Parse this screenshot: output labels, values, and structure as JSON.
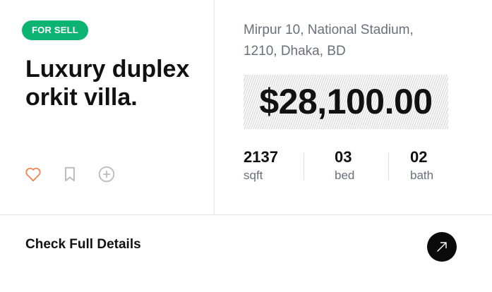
{
  "listing": {
    "badge": "FOR SELL",
    "title": "Luxury duplex orkit villa.",
    "address_line1": "Mirpur 10, National Stadium,",
    "address_line2": "1210, Dhaka, BD",
    "price": "$28,100.00",
    "stats": [
      {
        "value": "2137",
        "unit": "sqft"
      },
      {
        "value": "03",
        "unit": "bed"
      },
      {
        "value": "02",
        "unit": "bath"
      }
    ]
  },
  "actions": {
    "icons": [
      "heart-icon",
      "bookmark-icon",
      "plus-circle-icon"
    ]
  },
  "footer": {
    "details_label": "Check Full Details",
    "go_icon": "arrow-up-right-icon"
  },
  "colors": {
    "badge_bg": "#0db373",
    "heart": "#f0854f",
    "muted_icon": "#b9b9b9",
    "text": "#111111",
    "secondary_text": "#6a6f7a",
    "button_bg": "#0b0b0b"
  }
}
